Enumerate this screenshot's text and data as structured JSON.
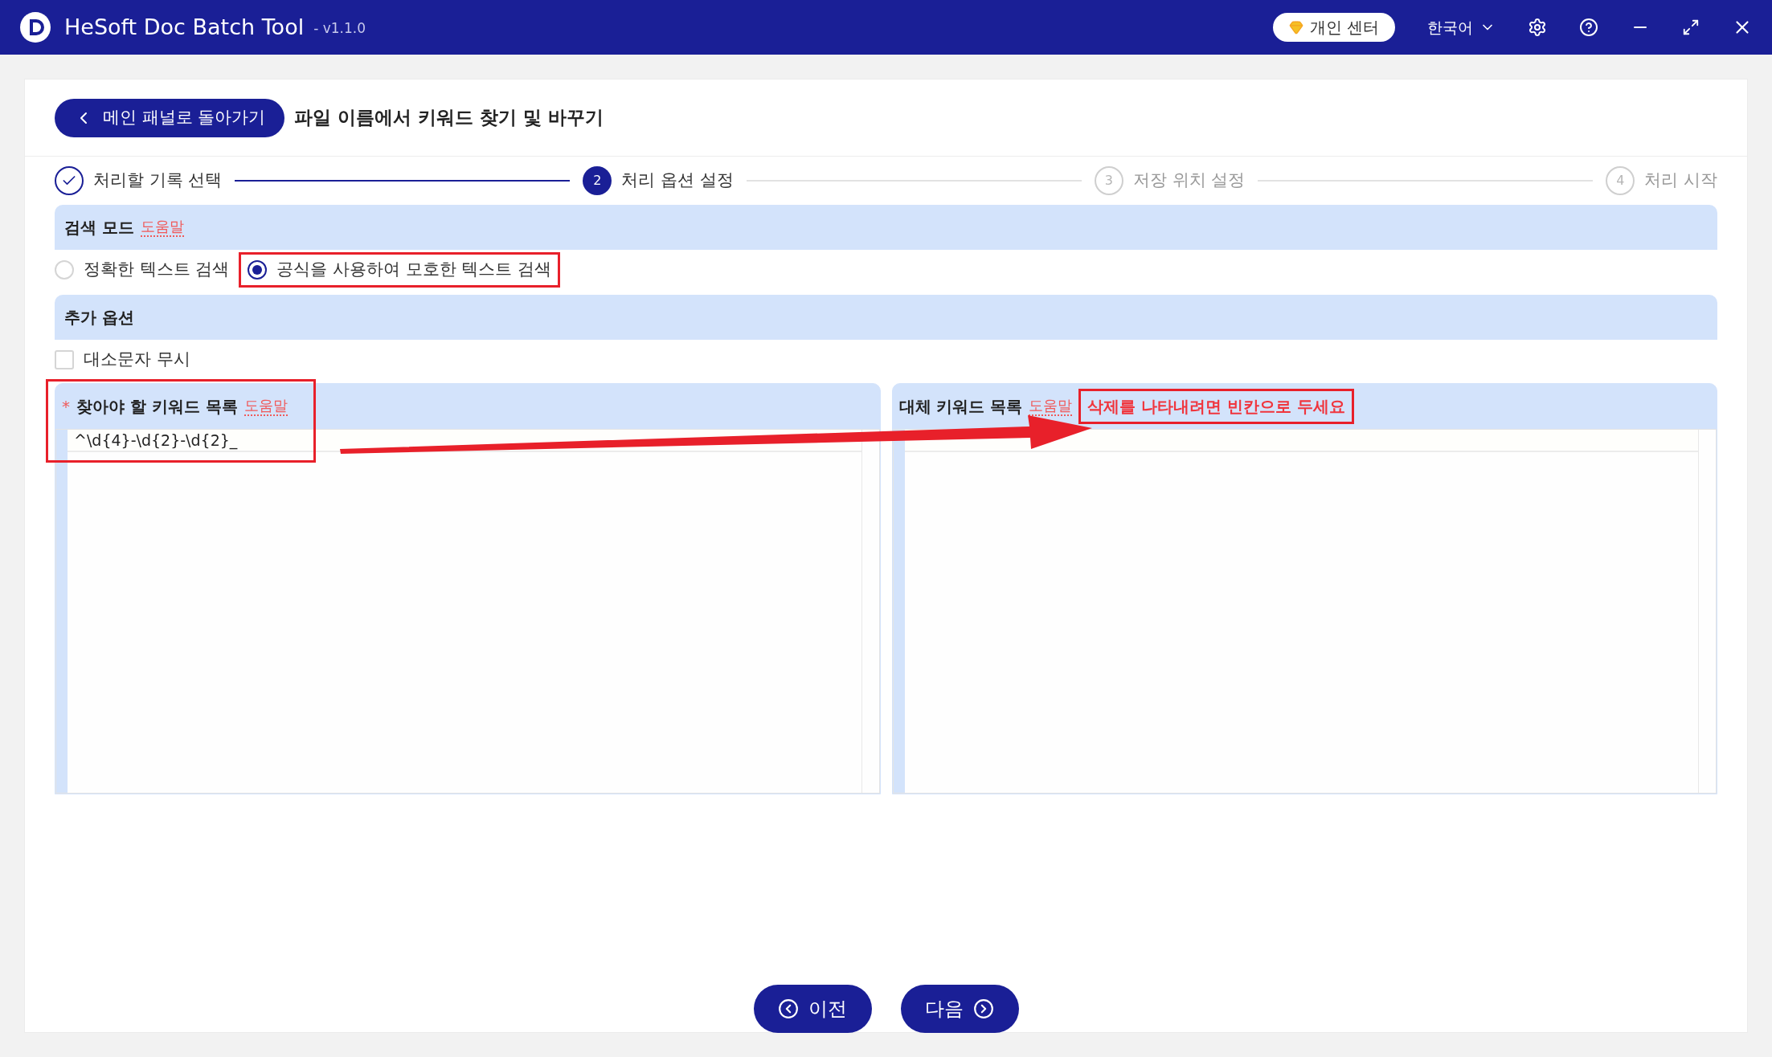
{
  "window": {
    "title": "HeSoft Doc Batch Tool",
    "version": "- v1.1.0",
    "profile_button": "개인 센터",
    "language": "한국어"
  },
  "header": {
    "back_button": "메인 패널로 돌아가기",
    "page_title": "파일 이름에서 키워드 찾기 및 바꾸기"
  },
  "steps": [
    {
      "label": "처리할 기록 선택",
      "completed": true,
      "current": false
    },
    {
      "number": "2",
      "label": "처리 옵션 설정",
      "completed": false,
      "current": true
    },
    {
      "number": "3",
      "label": "저장 위치 설정",
      "completed": false,
      "current": false
    },
    {
      "number": "4",
      "label": "처리 시작",
      "completed": false,
      "current": false
    }
  ],
  "search_mode": {
    "title": "검색 모드",
    "help": "도움말",
    "options": [
      {
        "label": "정확한 텍스트 검색",
        "selected": false,
        "highlighted": false
      },
      {
        "label": "공식을 사용하여 모호한 텍스트 검색",
        "selected": true,
        "highlighted": true
      }
    ]
  },
  "extra_options": {
    "title": "추가 옵션",
    "options": [
      {
        "label": "대소문자 무시",
        "checked": false
      }
    ]
  },
  "find_list": {
    "required_mark": "*",
    "title": "찾아야 할 키워드 목록",
    "help": "도움말",
    "value": "^\\d{4}-\\d{2}-\\d{2}_",
    "highlighted": true
  },
  "replace_list": {
    "title": "대체 키워드 목록",
    "help": "도움말",
    "note": "삭제를 나타내려면 빈칸으로 두세요",
    "highlighted": true
  },
  "buttons": {
    "previous": "이전",
    "next": "다음"
  }
}
